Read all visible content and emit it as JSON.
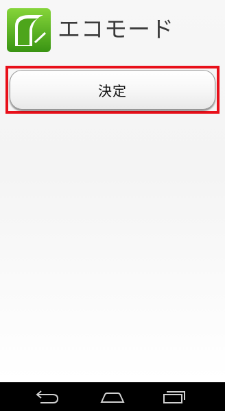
{
  "app": {
    "title": "エコモード",
    "icon": "eco-mode-app-icon",
    "icon_colors": {
      "green_top": "#7ccf2e",
      "green_bottom": "#3a9a14"
    }
  },
  "main": {
    "confirm_label": "決定",
    "highlight_color": "#e8101a"
  },
  "nav_bar": {
    "items": [
      {
        "icon": "back-icon"
      },
      {
        "icon": "home-icon"
      },
      {
        "icon": "recent-apps-icon"
      }
    ]
  }
}
